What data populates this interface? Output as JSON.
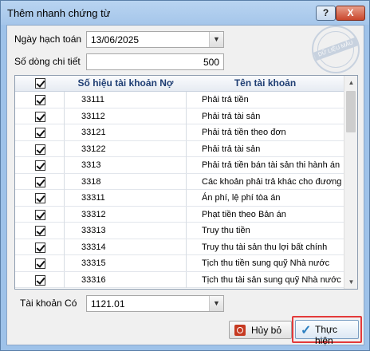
{
  "window": {
    "title": "Thêm nhanh chứng từ",
    "help_label": "?",
    "close_label": "X"
  },
  "form": {
    "date_label": "Ngày hạch toán",
    "date_value": "13/06/2025",
    "rows_label": "Số dòng chi tiết",
    "rows_value": "500",
    "co_label": "Tài khoản Có",
    "co_value": "1121.01"
  },
  "stamp": {
    "text": "DỮ LIỆU MẪU"
  },
  "grid": {
    "headers": [
      "Số hiệu tài khoản Nợ",
      "Tên tài khoản"
    ],
    "header_checked": true,
    "rows": [
      {
        "checked": true,
        "code": "33111",
        "name": "Phải trả tiền"
      },
      {
        "checked": true,
        "code": "33112",
        "name": "Phải trả tài sản"
      },
      {
        "checked": true,
        "code": "33121",
        "name": "Phải trả tiền theo đơn"
      },
      {
        "checked": true,
        "code": "33122",
        "name": "Phải trả tài sản"
      },
      {
        "checked": true,
        "code": "3313",
        "name": "Phải trả tiền bán tài sản thi hành án"
      },
      {
        "checked": true,
        "code": "3318",
        "name": "Các khoản phải trả khác cho đương"
      },
      {
        "checked": true,
        "code": "33311",
        "name": "Án phí, lệ phí tòa án"
      },
      {
        "checked": true,
        "code": "33312",
        "name": "Phạt tiền theo Bản án"
      },
      {
        "checked": true,
        "code": "33313",
        "name": "Truy thu tiền"
      },
      {
        "checked": true,
        "code": "33314",
        "name": "Truy thu tài sản thu lợi bất chính"
      },
      {
        "checked": true,
        "code": "33315",
        "name": "Tịch thu tiền sung quỹ Nhà nước"
      },
      {
        "checked": true,
        "code": "33316",
        "name": "Tịch thu tài sản sung quỹ Nhà nước"
      }
    ]
  },
  "buttons": {
    "cancel_label": "Hủy bỏ",
    "ok_label": "Thực hiện"
  },
  "icons": {
    "dropdown": "chevron-down-icon",
    "cancel": "power-icon",
    "ok": "checkmark-icon"
  },
  "colors": {
    "window_frame": "#9ec2e9",
    "header_text": "#1f3e73",
    "highlight": "#e33a3a",
    "close_button": "#c9462c"
  }
}
